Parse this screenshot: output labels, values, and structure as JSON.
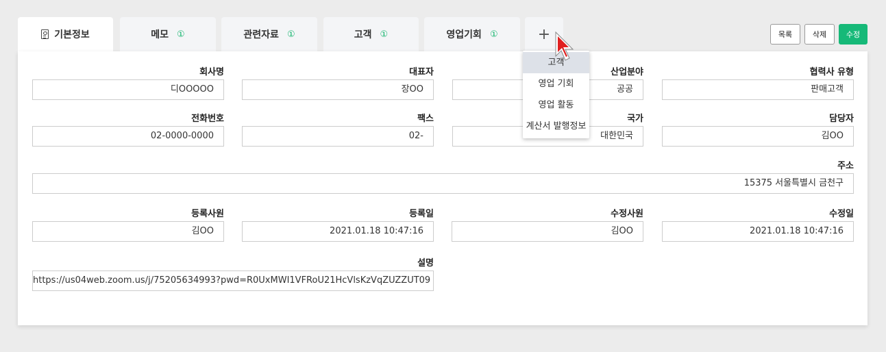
{
  "tabs": {
    "basic": "기본정보",
    "memo": "메모",
    "memo_badge": "①",
    "docs": "관련자료",
    "docs_badge": "①",
    "customer": "고객",
    "customer_badge": "①",
    "opportunity": "영업기회",
    "opportunity_badge": "①",
    "add": "+"
  },
  "actions": {
    "list": "목록",
    "delete": "삭제",
    "edit": "수정"
  },
  "dropdown": {
    "items": [
      "고객",
      "영업 기회",
      "영업 활동",
      "계산서 발행정보"
    ]
  },
  "form": {
    "company_name": {
      "label": "회사명",
      "value": "디OOOOO"
    },
    "ceo": {
      "label": "대표자",
      "value": "장OO"
    },
    "industry": {
      "label": "산업분야",
      "value": "공공"
    },
    "partner_type": {
      "label": "협력사 유형",
      "value": "판매고객"
    },
    "phone": {
      "label": "전화번호",
      "value": "02-0000-0000"
    },
    "fax": {
      "label": "팩스",
      "value": "02-"
    },
    "country": {
      "label": "국가",
      "value": "대한민국"
    },
    "manager": {
      "label": "담당자",
      "value": "김OO"
    },
    "address": {
      "label": "주소",
      "value": "15375 서울특별시 금천구"
    },
    "registered_by": {
      "label": "등록사원",
      "value": "김OO"
    },
    "registered_at": {
      "label": "등록일",
      "value": "2021.01.18  10:47:16"
    },
    "modified_by": {
      "label": "수정사원",
      "value": "김OO"
    },
    "modified_at": {
      "label": "수정일",
      "value": "2021.01.18  10:47:16"
    },
    "description": {
      "label": "설명",
      "value": "https://us04web.zoom.us/j/75205634993?pwd=R0UxMWI1VFRoU21HcVlsKzVqZUZZUT09"
    }
  },
  "colors": {
    "accent": "#16b978",
    "badge": "#10b36b",
    "cursor": "#e02020"
  }
}
